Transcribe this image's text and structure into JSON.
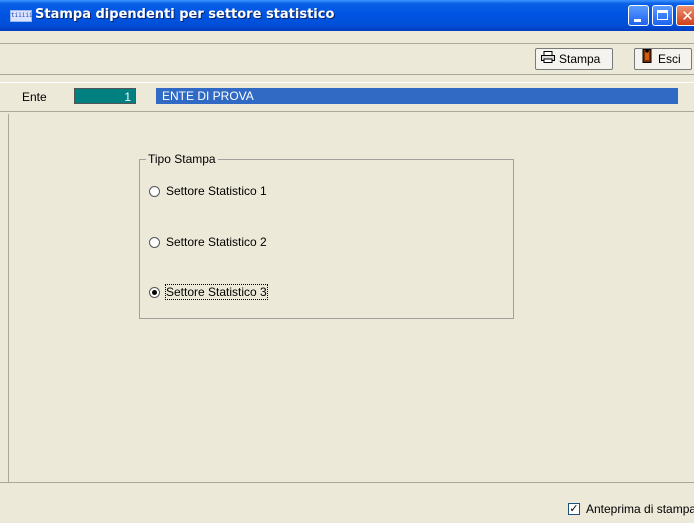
{
  "window": {
    "title": "Stampa dipendenti per settore statistico",
    "app_icon_text": "tiiiii"
  },
  "toolbar": {
    "stampa_label": "Stampa",
    "esci_label": "Esci"
  },
  "ente": {
    "label": "Ente",
    "code": "1",
    "name": "ENTE DI PROVA"
  },
  "tipo_stampa": {
    "legend": "Tipo Stampa",
    "options": [
      {
        "label": "Settore Statistico 1",
        "checked": false
      },
      {
        "label": "Settore Statistico 2",
        "checked": false
      },
      {
        "label": "Settore Statistico 3",
        "checked": true
      }
    ]
  },
  "footer": {
    "anteprima_label": "Anteprima di stampa",
    "anteprima_checked": true
  },
  "icons": {
    "print": "printer-icon",
    "exit": "door-exit-icon"
  },
  "colors": {
    "titlebar": "#0054e3",
    "ente_code_bg": "#008080",
    "ente_name_bg": "#316ac5",
    "window_bg": "#ece9d8"
  }
}
